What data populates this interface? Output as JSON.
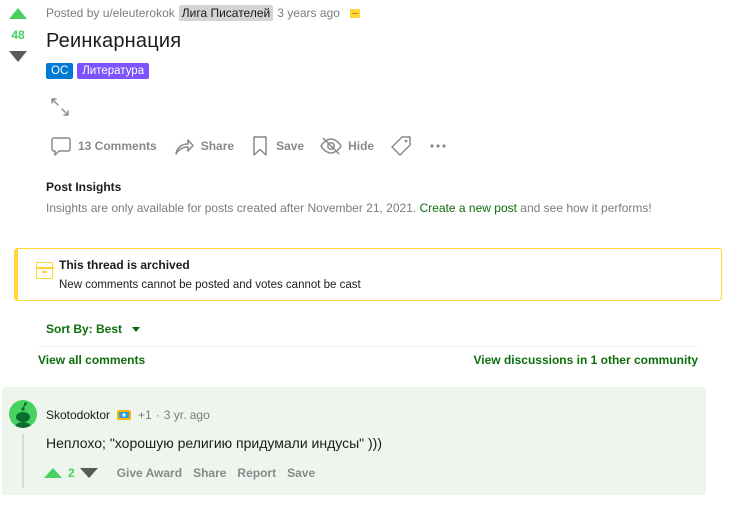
{
  "post": {
    "score": "48",
    "posted_by": "Posted by u/eleuterokok",
    "author_flair": "Лига Писателей",
    "time": "3 years ago",
    "title": "Реинкарнация",
    "flairs": [
      "OC",
      "Литература"
    ],
    "actions": {
      "comments": "13 Comments",
      "share": "Share",
      "save": "Save",
      "hide": "Hide"
    }
  },
  "insights": {
    "title": "Post Insights",
    "text_before": "Insights are only available for posts created after November 21, 2021.",
    "link": "Create a new post",
    "text_after": "and see how it performs!"
  },
  "archived": {
    "title": "This thread is archived",
    "text": "New comments cannot be posted and votes cannot be cast"
  },
  "sort": {
    "label": "Sort By: Best"
  },
  "links": {
    "view_all": "View all comments",
    "view_other": "View discussions in 1 other community"
  },
  "comment": {
    "author": "Skotodoktor",
    "award_count": "+1",
    "time": "3 yr. ago",
    "body": "Неплохо; \"хорошую религию придумали индусы\" )))",
    "score": "2",
    "actions": {
      "give_award": "Give Award",
      "share": "Share",
      "report": "Report",
      "save": "Save"
    }
  },
  "colors": {
    "upvote": "#46d160",
    "link_green": "#0d6e0d",
    "archived_border": "#ffd635",
    "flair_blue": "#0079d3",
    "flair_purple": "#7e53ff",
    "comment_bg": "#edf5ed"
  }
}
